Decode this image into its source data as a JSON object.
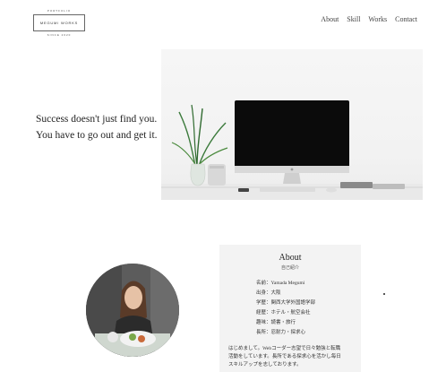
{
  "logo": {
    "top_text": "PORTFOLIO",
    "main_text": "MEGUMI WORKS",
    "bottom_text": "SINCE 2020"
  },
  "nav": {
    "items": [
      "About",
      "Skill",
      "Works",
      "Contact"
    ]
  },
  "hero": {
    "line1": "Success doesn't just find you.",
    "line2": "You have to go out and get it."
  },
  "about": {
    "title": "About",
    "subtitle": "自己紹介",
    "profile": [
      "名前：Yamada Megumi",
      "出身：大阪",
      "学歴：関西大学外国語学部",
      "経歴：ホテル・航空会社",
      "趣味：読書・旅行",
      "長所：忍耐力・探求心"
    ],
    "bio_lines": [
      "はじめまして。Webコーダー志望で日々勉強と転職",
      "活動をしています。長所である探求心を活かし毎日",
      "スキルアップを志しております。"
    ]
  }
}
